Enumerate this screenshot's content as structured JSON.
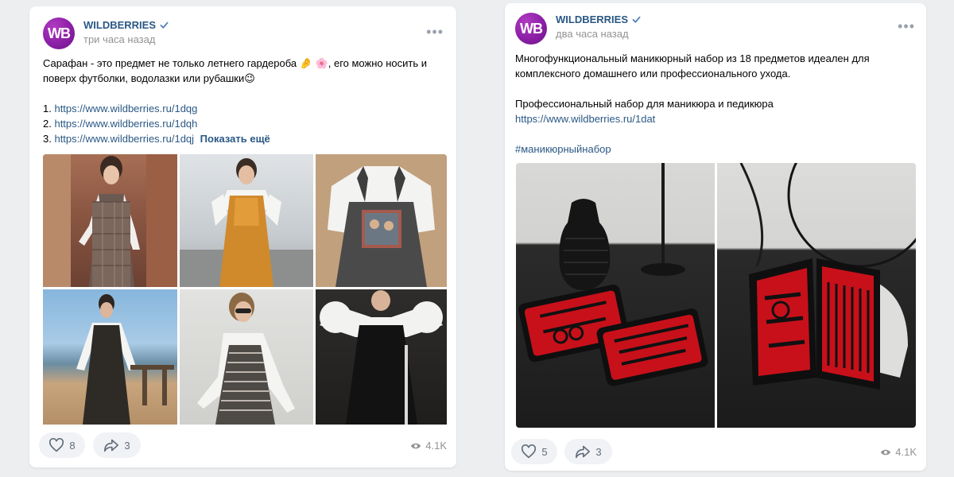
{
  "posts": [
    {
      "author": "WILDBERRIES",
      "avatar_text": "WB",
      "time": "три часа назад",
      "text_line1": "Сарафан - это предмет не только летнего гардероба",
      "text_line1_tail": ", его можно носить и",
      "text_line2": "поверх футболки, водолазки или рубашки",
      "links": [
        {
          "num": "1.",
          "url": "https://www.wildberries.ru/1dqg"
        },
        {
          "num": "2.",
          "url": "https://www.wildberries.ru/1dqh"
        },
        {
          "num": "3.",
          "url": "https://www.wildberries.ru/1dqj"
        }
      ],
      "show_more": "Показать ещё",
      "likes": "8",
      "shares": "3",
      "views": "4.1K"
    },
    {
      "author": "WILDBERRIES",
      "avatar_text": "WB",
      "time": "два часа назад",
      "text_line1": "Многофункциональный маникюрный набор из 18 предметов идеален для",
      "text_line2": "комплексного домашнего или профессионального ухода.",
      "text_line3": "Профессиональный набор для маникюра и педикюра",
      "link": "https://www.wildberries.ru/1dat",
      "hashtag": "#маникюрныйнабор",
      "likes": "5",
      "shares": "3",
      "views": "4.1K"
    }
  ],
  "icons": {
    "verified": "verified-check-icon",
    "more": "more-dots-icon",
    "like": "heart-icon",
    "share": "share-arrow-icon",
    "views": "eye-icon"
  },
  "colors": {
    "link": "#2a5885",
    "brand": "#8b1fa6",
    "muted": "#939393",
    "background": "#edeef0"
  }
}
